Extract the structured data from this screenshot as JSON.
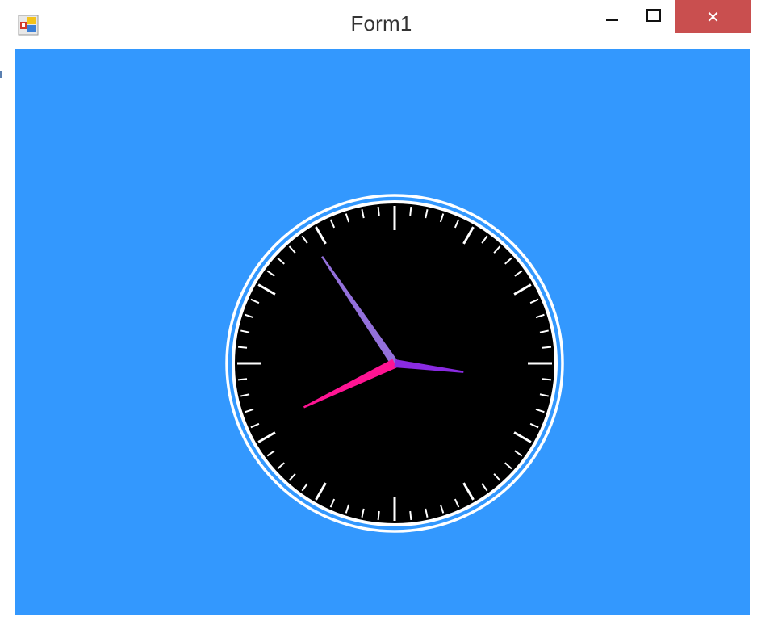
{
  "window": {
    "title": "Form1",
    "icon": "winforms-app-icon",
    "controls": {
      "minimize_icon": "minimize-icon",
      "maximize_icon": "maximize-icon",
      "close_label": "✕"
    },
    "close_color": "#c94f4f"
  },
  "form": {
    "background_color": "#3398fe"
  },
  "clock": {
    "face_color": "#000000",
    "ring_color": "#ffffff",
    "tick_color": "#ffffff",
    "time": {
      "hours": 3,
      "minutes": 54.3,
      "seconds": 40.7
    },
    "hands": {
      "hour_color": "#8a2be2",
      "minute_color": "#9370db",
      "second_color": "#ff1493"
    }
  }
}
